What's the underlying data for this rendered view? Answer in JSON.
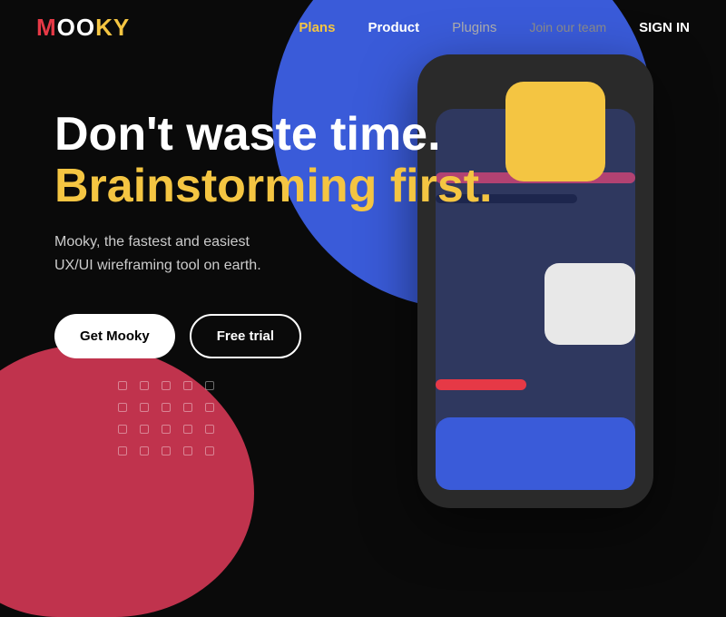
{
  "logo": {
    "m": "M",
    "oo": "OO",
    "ky": "KY"
  },
  "nav": {
    "plans": "Plans",
    "product": "Product",
    "plugins": "Plugins",
    "join": "Join our team",
    "signin": "SIGN IN"
  },
  "hero": {
    "line1": "Don't waste time.",
    "line2": "Brainstorming first.",
    "subtitle_line1": "Mooky, the fastest and easiest",
    "subtitle_line2": "UX/UI wireframing tool on earth.",
    "btn_primary": "Get Mooky",
    "btn_outline": "Free trial"
  }
}
